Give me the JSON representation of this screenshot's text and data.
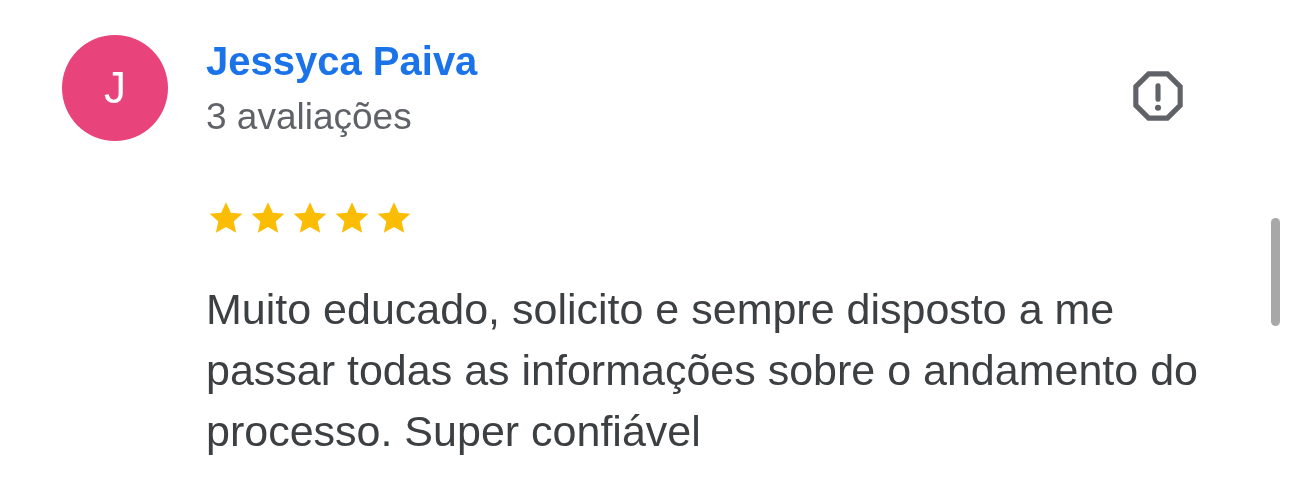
{
  "reviewer": {
    "initial": "J",
    "name": "Jessyca Paiva",
    "meta": "3 avaliações"
  },
  "review": {
    "stars": 5,
    "text": "Muito educado, solicito e sempre disposto a me passar todas as informações sobre o andamento do processo. Super confiável"
  }
}
